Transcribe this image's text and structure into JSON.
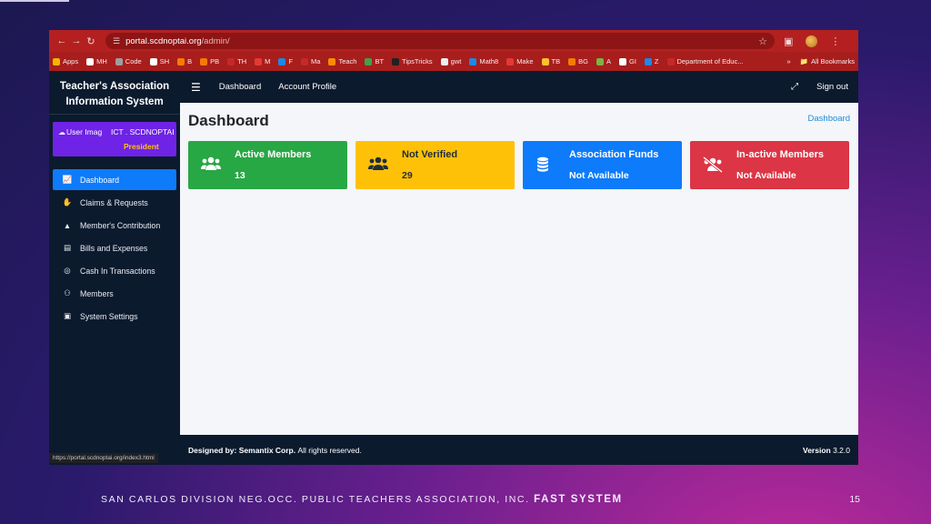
{
  "browser": {
    "url_host": "portal.scdnoptai.org",
    "url_path": "/admin/",
    "status_url": "https://portal.scdnoptai.org/index3.html",
    "bookmarks": [
      {
        "label": "Apps",
        "color": "#f4b400"
      },
      {
        "label": "MH",
        "color": "#ffffff"
      },
      {
        "label": "Code",
        "color": "#9e9e9e"
      },
      {
        "label": "SH",
        "color": "#ffffff"
      },
      {
        "label": "B",
        "color": "#f57c00"
      },
      {
        "label": "PB",
        "color": "#f57c00"
      },
      {
        "label": "TH",
        "color": "#c62828"
      },
      {
        "label": "M",
        "color": "#e53935"
      },
      {
        "label": "F",
        "color": "#1e88e5"
      },
      {
        "label": "Ma",
        "color": "#c62828"
      },
      {
        "label": "Teach",
        "color": "#fb8c00"
      },
      {
        "label": "BT",
        "color": "#43a047"
      },
      {
        "label": "TipsTricks",
        "color": "#212121"
      },
      {
        "label": "gwt",
        "color": "#eeeeee"
      },
      {
        "label": "Math8",
        "color": "#1e88e5"
      },
      {
        "label": "Make",
        "color": "#e53935"
      },
      {
        "label": "TB",
        "color": "#fbc02d"
      },
      {
        "label": "BG",
        "color": "#f57c00"
      },
      {
        "label": "A",
        "color": "#7cb342"
      },
      {
        "label": "GI",
        "color": "#ffffff"
      },
      {
        "label": "Z",
        "color": "#1e88e5"
      },
      {
        "label": "Department of Educ...",
        "color": "#c62828"
      }
    ],
    "overflow_label": "»",
    "all_bookmarks_label": "All Bookmarks"
  },
  "sidebar": {
    "brand": "Teacher's Association Information System",
    "user": {
      "image_alt": "User Imag",
      "name": "ICT . SCDNOPTAI",
      "role": "President"
    },
    "items": [
      {
        "label": "Dashboard",
        "icon": "chart-line-icon",
        "active": true
      },
      {
        "label": "Claims & Requests",
        "icon": "handshake-icon",
        "active": false
      },
      {
        "label": "Member's Contribution",
        "icon": "hand-coin-icon",
        "active": false
      },
      {
        "label": "Bills and Expenses",
        "icon": "receipt-icon",
        "active": false
      },
      {
        "label": "Cash In Transactions",
        "icon": "coins-icon",
        "active": false
      },
      {
        "label": "Members",
        "icon": "users-icon",
        "active": false
      },
      {
        "label": "System Settings",
        "icon": "toolbox-icon",
        "active": false
      }
    ]
  },
  "topnav": {
    "links": [
      "Dashboard",
      "Account Profile"
    ],
    "signout": "Sign out"
  },
  "main": {
    "title": "Dashboard",
    "breadcrumb": "Dashboard",
    "cards": [
      {
        "label": "Active Members",
        "value": "13",
        "color": "#28a745",
        "icon": "users-icon"
      },
      {
        "label": "Not Verified",
        "value": "29",
        "color": "#ffc107",
        "icon": "users-icon"
      },
      {
        "label": "Association Funds",
        "value": "Not Available",
        "color": "#0d7bfa",
        "icon": "coins-icon"
      },
      {
        "label": "In-active Members",
        "value": "Not Available",
        "color": "#dc3545",
        "icon": "users-slash-icon"
      }
    ]
  },
  "footer": {
    "designed_by_label": "Designed by:",
    "designed_by": "Semantix Corp.",
    "rights": "All rights reserved.",
    "version_label": "Version",
    "version": "3.2.0"
  },
  "slide": {
    "caption": "SAN CARLOS DIVISION NEG.OCC. PUBLIC TEACHERS ASSOCIATION, INC.",
    "caption_strong": "FAST SYSTEM",
    "page_number": "15"
  }
}
